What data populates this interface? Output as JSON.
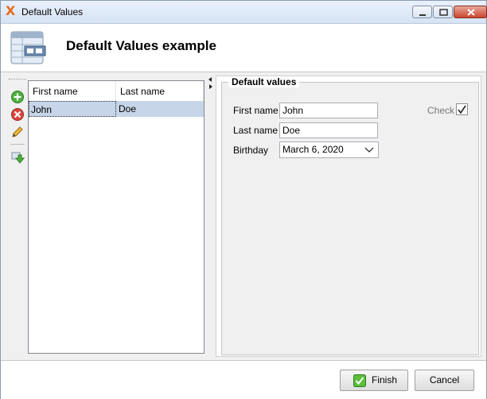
{
  "window": {
    "title": "Default Values",
    "app_icon_glyph": "X"
  },
  "banner": {
    "title": "Default Values example",
    "icon": "table-form-icon"
  },
  "toolbar": {
    "items": [
      "add-icon",
      "delete-icon",
      "edit-icon",
      "download-icon"
    ]
  },
  "grid": {
    "columns": [
      "First name",
      "Last name"
    ],
    "rows": [
      {
        "first": "John",
        "last": "Doe"
      }
    ]
  },
  "form": {
    "legend": "Default values",
    "first_name_label": "First name",
    "first_name_value": "John",
    "last_name_label": "Last name",
    "last_name_value": "Doe",
    "birthday_label": "Birthday",
    "birthday_value": "March 6, 2020",
    "check_label": "Check",
    "check_checked": true
  },
  "footer": {
    "finish_label": "Finish",
    "cancel_label": "Cancel"
  },
  "colors": {
    "selection": "#c6d5e8",
    "accent": "#e86a1c"
  }
}
